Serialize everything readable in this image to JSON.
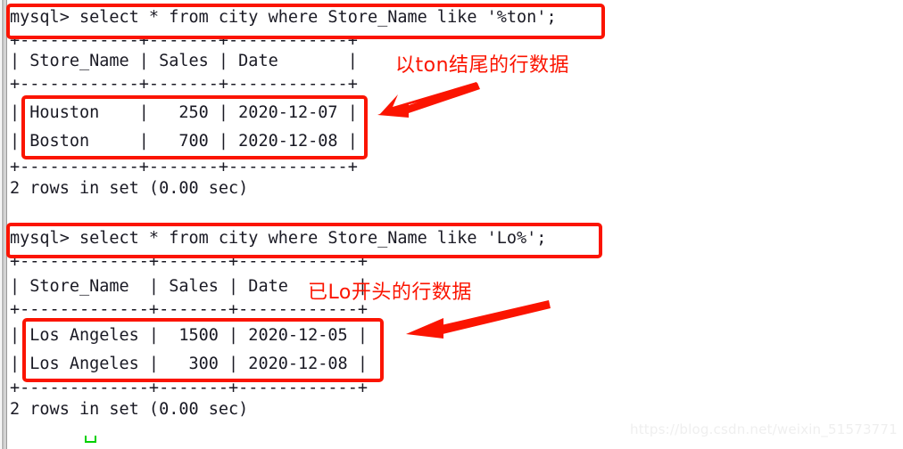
{
  "terminal": {
    "blocks": [
      {
        "id": "block-1",
        "prompt": "mysql> ",
        "command": "select * from city where Store_Name like '%ton';",
        "full_command_line": "mysql> select * from city where Store_Name like '%ton';",
        "border_top": "+------------+-------+------------+",
        "header_row": "| Store_Name | Sales | Date       |",
        "border_mid": "+------------+-------+------------+",
        "data_rows": [
          "| Houston    |   250 | 2020-12-07 |",
          "| Boston     |   700 | 2020-12-08 |"
        ],
        "border_bottom": "+------------+-------+------------+",
        "status": "2 rows in set (0.00 sec)",
        "columns": [
          "Store_Name",
          "Sales",
          "Date"
        ],
        "rows": [
          {
            "Store_Name": "Houston",
            "Sales": "250",
            "Date": "2020-12-07"
          },
          {
            "Store_Name": "Boston",
            "Sales": "700",
            "Date": "2020-12-08"
          }
        ]
      },
      {
        "id": "block-2",
        "prompt": "mysql> ",
        "command": "select * from city where Store_Name like 'Lo%';",
        "full_command_line": "mysql> select * from city where Store_Name like 'Lo%';",
        "border_top": "+-------------+-------+------------+",
        "header_row": "| Store_Name  | Sales | Date       |",
        "border_mid": "+-------------+-------+------------+",
        "data_rows": [
          "| Los Angeles |  1500 | 2020-12-05 |",
          "| Los Angeles |   300 | 2020-12-08 |"
        ],
        "border_bottom": "+-------------+-------+------------+",
        "status": "2 rows in set (0.00 sec)",
        "columns": [
          "Store_Name",
          "Sales",
          "Date"
        ],
        "rows": [
          {
            "Store_Name": "Los Angeles",
            "Sales": "1500",
            "Date": "2020-12-05"
          },
          {
            "Store_Name": "Los Angeles",
            "Sales": "300",
            "Date": "2020-12-08"
          }
        ]
      }
    ]
  },
  "annotations": {
    "color": "#fb1400",
    "note_1": "以ton结尾的行数据",
    "note_2": "已Lo开头的行数据"
  },
  "cursor": {
    "color": "#00d100"
  },
  "watermark": {
    "text": "https://blog.csdn.net/weixin_51573771",
    "color": "#efefef"
  }
}
